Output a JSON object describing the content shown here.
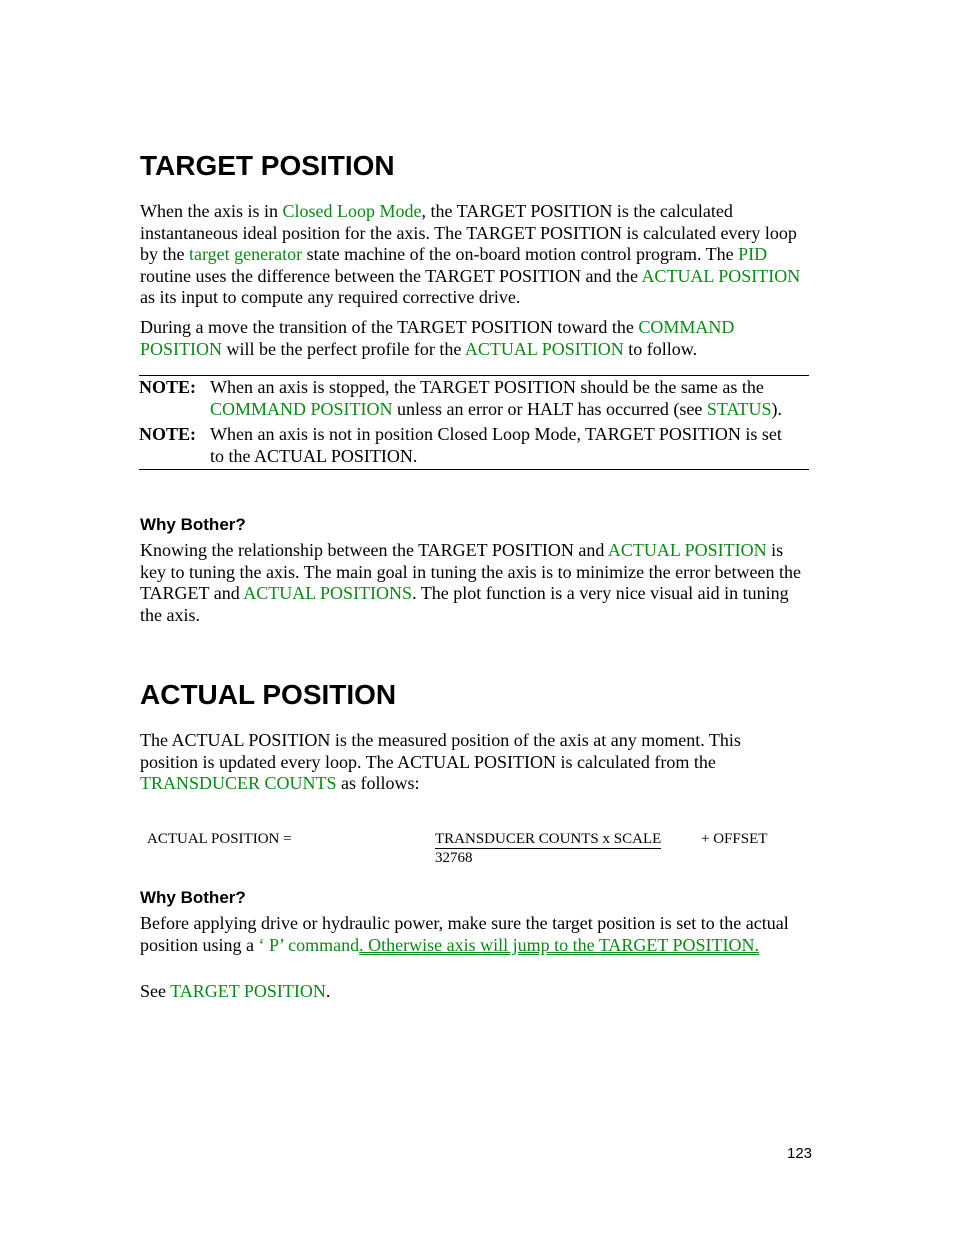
{
  "section1": {
    "title": "TARGET POSITION",
    "p1": {
      "t1": "When the axis is in ",
      "l1": "Closed Loop Mode",
      "t2": ", the TARGET POSITION is the calculated instantaneous ideal position for the axis.  The TARGET POSITION is calculated every loop by the ",
      "l2": "target generator",
      "t3": " state machine of the on-board motion control program.  The ",
      "l3": "PID",
      "t4": " routine uses the difference between the TARGET POSITION and the ",
      "l4": "ACTUAL POSITION",
      "t5": " as its input to compute any required corrective drive."
    },
    "p2": {
      "t1": "During a move the transition of the TARGET POSITION toward the ",
      "l1": "COMMAND POSITION",
      "t2": " will be the perfect profile for the ",
      "l2": "ACTUAL POSITION",
      "t3": " to follow."
    },
    "notes": {
      "n1": {
        "label": "NOTE:",
        "t1": "When an axis is stopped, the TARGET POSITION should be the same as the ",
        "l1": "COMMAND POSITION",
        "t2": " unless an error or HALT has occurred (see ",
        "l2": "STATUS",
        "t3": ")."
      },
      "n2": {
        "label": "NOTE:",
        "t1": "When an axis is not in position Closed Loop Mode, TARGET POSITION is set to the ACTUAL POSITION."
      }
    },
    "why": {
      "heading": "Why Bother?",
      "t1": "Knowing the relationship between the TARGET POSITION and ",
      "l1": "ACTUAL POSITION",
      "t2": " is key to tuning the axis.  The main goal in tuning the axis is to minimize the error between the TARGET and ",
      "l2": "ACTUAL POSITIONS",
      "t3": ".  The plot function is a very nice visual aid in tuning the axis."
    }
  },
  "section2": {
    "title": "ACTUAL POSITION",
    "p1": {
      "t1": "The ACTUAL POSITION is the measured position of the axis at any moment.  This position is updated every loop.  The ACTUAL POSITION is calculated from the ",
      "l1": "TRANSDUCER COUNTS",
      "t2": " as follows:"
    },
    "formula": {
      "lhs": "ACTUAL POSITION =",
      "numerator": "TRANSDUCER COUNTS x SCALE",
      "denominator": "32768",
      "offset": "+ OFFSET"
    },
    "why": {
      "heading": "Why Bother?",
      "t1": "Before applying drive or hydraulic power, make sure the target position is set to the actual position using a ",
      "l1": "‘ P’ command",
      "l2": ".  Otherwise axis will jump to the TARGET POSITION.",
      "see": "See ",
      "l3": "TARGET POSITION",
      "end": "."
    }
  },
  "footer": {
    "page_number": "123"
  },
  "colors": {
    "link": "#0a8a14",
    "text": "#000000"
  }
}
